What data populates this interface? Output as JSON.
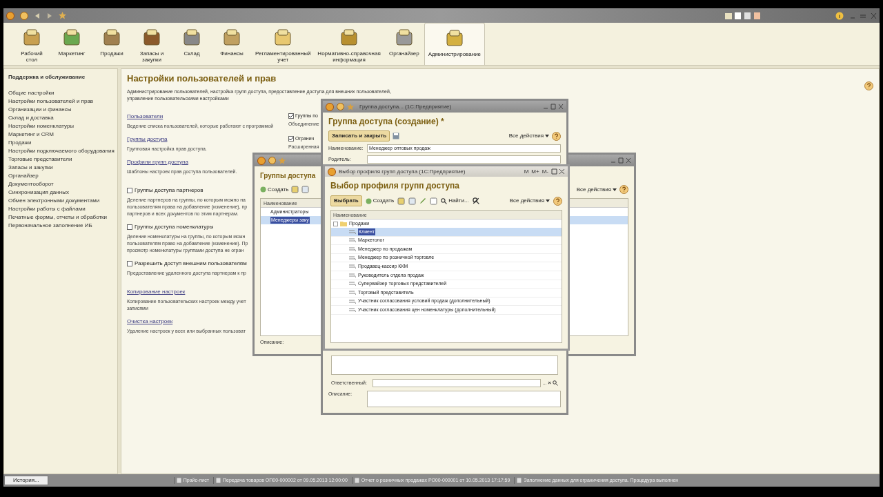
{
  "sections": [
    {
      "label": "Рабочий\nстол",
      "selected": false
    },
    {
      "label": "Маркетинг",
      "selected": false
    },
    {
      "label": "Продажи",
      "selected": false
    },
    {
      "label": "Запасы и\nзакупки",
      "selected": false
    },
    {
      "label": "Склад",
      "selected": false
    },
    {
      "label": "Финансы",
      "selected": false
    },
    {
      "label": "Регламентированный\nучет",
      "selected": false
    },
    {
      "label": "Нормативно-справочная\nинформация",
      "selected": false
    },
    {
      "label": "Органайзер",
      "selected": false
    },
    {
      "label": "Администрирование",
      "selected": true
    }
  ],
  "sidebar": {
    "title": "Поддержка и обслуживание",
    "items": [
      "Общие настройки",
      "Настройки пользователей и прав",
      "Организации и финансы",
      "Склад и доставка",
      "Настройки номенклатуры",
      "Маркетинг и CRM",
      "Продажи",
      "Настройки подключаемого оборудования",
      "Торговые представители",
      "Запасы и закупки",
      "Органайзер",
      "Документооборот",
      "Синхронизация данных",
      "Обмен электронными документами",
      "Настройки работы с файлами",
      "Печатные формы, отчеты и обработки",
      "Первоначальное заполнение ИБ"
    ]
  },
  "content": {
    "title": "Настройки пользователей и прав",
    "description": "Администрирование пользователей, настройка групп доступа, предоставление доступа для внешних пользователей,\nуправление пользовательскими настройками",
    "left_items": [
      {
        "kind": "link",
        "label": "Пользователи",
        "text": "Ведение списка пользователей, которые работают с программой"
      },
      {
        "kind": "link",
        "label": "Группы доступа",
        "text": "Групповая настройка прав доступа."
      },
      {
        "kind": "link",
        "label": "Профили групп доступа",
        "text": "Шаблоны настроек прав доступа пользователей."
      },
      {
        "kind": "checkbox",
        "label": "Группы доступа партнеров",
        "checked": false,
        "text": "Деление партнеров на группы, по которым можно на\nпользователям права на добавление (изменение), пр\nпартнеров и всех документов по этим партнерам."
      },
      {
        "kind": "checkbox",
        "label": "Группы доступа номенклатуры",
        "checked": false,
        "text": "Деление номенклатуры на группы, по которым можн\nпользователям право на добавление (изменение). Пр\nпросмотр номенклатуры группами доступа не огран"
      },
      {
        "kind": "checkbox",
        "label": "Разрешить доступ внешним пользователям",
        "checked": false,
        "text": "Предоставление удаленного доступа партнерам к пр"
      },
      {
        "kind": "link",
        "label": "Копирование настроек",
        "text": "Копирование пользовательских настроек между учет\nзаписями"
      },
      {
        "kind": "link",
        "label": "Очистка настроек",
        "text": "Удаление настроек у всех или выбранных пользоват"
      }
    ],
    "right_items": [
      {
        "kind": "checkbox",
        "label": "Группы по",
        "checked": true
      },
      {
        "kind": "text",
        "label": "Объединение"
      },
      {
        "kind": "checkbox",
        "label": "Огранич",
        "checked": true
      },
      {
        "kind": "text",
        "label": "Расширенная"
      }
    ]
  },
  "groups_window": {
    "heading": "Группы доступа",
    "create": "Создать",
    "all_actions": "Все действия",
    "column": "Наименование",
    "rows": [
      {
        "label": "Администраторы",
        "selected": false
      },
      {
        "label": "Менеджеры заку",
        "selected": true
      }
    ],
    "description_label": "Описание:"
  },
  "group_window": {
    "title": "Группа доступа...  (1С:Предприятие)",
    "heading": "Группа доступа (создание) *",
    "save_close": "Записать и закрыть",
    "all_actions": "Все действия",
    "fields": [
      {
        "label": "Наименование:",
        "value": "Менеджер оптовых продаж"
      },
      {
        "label": "Родитель:"
      }
    ],
    "responsible_label": "Ответственный:",
    "choose": "...",
    "clear": "×",
    "description_label": "Описание:"
  },
  "profile_window": {
    "title": "Выбор профиля групп доступа  (1С:Предприятие)",
    "heading": "Выбор профиля групп доступа",
    "select": "Выбрать",
    "create": "Создать",
    "find": "Найти...",
    "all_actions": "Все действия",
    "column": "Наименование",
    "title_buttons": [
      "M",
      "M+",
      "M-"
    ],
    "tree": [
      {
        "label": "Продажи",
        "expanded": true,
        "children": [
          {
            "label": "Клиент",
            "selected": true
          },
          {
            "label": "Маркетолог",
            "selected": false
          },
          {
            "label": "Менеджер по продажам",
            "selected": false
          },
          {
            "label": "Менеджер по розничной торговле",
            "selected": false
          },
          {
            "label": "Продавец-кассир ККМ",
            "selected": false
          },
          {
            "label": "Руководитель отдела продаж",
            "selected": false
          },
          {
            "label": "Супервайзер торговых представителей",
            "selected": false
          },
          {
            "label": "Торговый представитель",
            "selected": false
          },
          {
            "label": "Участник согласования условий продаж (дополнительный)",
            "selected": false
          },
          {
            "label": "Участник согласования цен номенклатуры (дополнительный)",
            "selected": false
          }
        ]
      }
    ]
  },
  "status_bar": {
    "history": "История...",
    "items": [
      "Прайс-лист",
      "Передача товаров ОП00-000002 от 09.05.2013 12:00:00",
      "Отчет о розничных продажах РО00-000001 от 10.05.2013 17:17:59",
      "Заполнение данных для ограничения доступа. Процедура выполнен"
    ]
  }
}
